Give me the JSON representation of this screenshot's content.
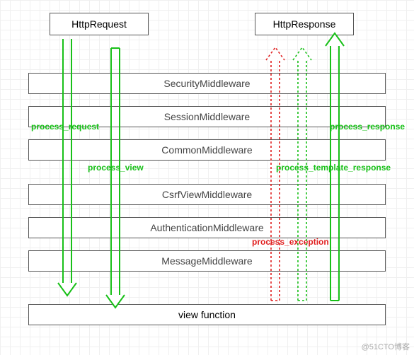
{
  "header": {
    "request": "HttpRequest",
    "response": "HttpResponse"
  },
  "middlewares": [
    "SecurityMiddleware",
    "SessionMiddleware",
    "CommonMiddleware",
    "CsrfViewMiddleware",
    "AuthenticationMiddleware",
    "MessageMiddleware"
  ],
  "view": "view function",
  "labels": {
    "process_request": "process_request",
    "process_view": "process_view",
    "process_response": "process_response",
    "process_template_response": "process_template_response",
    "process_exception": "process_exception"
  },
  "colors": {
    "request_arrow": "#18c018",
    "response_arrow": "#18c018",
    "template_arrow": "#18c018",
    "exception_arrow": "#e02020"
  },
  "watermark": "@51CTO博客"
}
